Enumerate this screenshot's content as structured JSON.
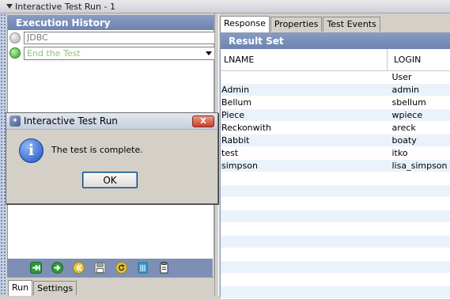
{
  "window": {
    "title": "Interactive Test Run - 1"
  },
  "history": {
    "header": "Execution History",
    "steps": [
      {
        "label": "JDBC"
      },
      {
        "label": "End the Test"
      }
    ]
  },
  "left_tabs": [
    {
      "label": "Run"
    },
    {
      "label": "Settings"
    }
  ],
  "toolbar": {
    "icons": [
      "step-into-icon",
      "step-forward-icon",
      "rewind-icon",
      "save-icon",
      "restart-icon",
      "delete-icon",
      "clipboard-icon"
    ]
  },
  "right_tabs": [
    {
      "label": "Response"
    },
    {
      "label": "Properties"
    },
    {
      "label": "Test Events"
    }
  ],
  "result_set": {
    "header": "Result Set",
    "columns": [
      "LNAME",
      "LOGIN"
    ],
    "rows": [
      [
        "",
        "User"
      ],
      [
        "Admin",
        "admin"
      ],
      [
        "Bellum",
        "sbellum"
      ],
      [
        "Piece",
        "wpiece"
      ],
      [
        "Reckonwith",
        "areck"
      ],
      [
        "Rabbit",
        "boaty"
      ],
      [
        "test",
        "itko"
      ],
      [
        "simpson",
        "lisa_simpson"
      ]
    ]
  },
  "dialog": {
    "title": "Interactive Test Run",
    "message": "The test is complete.",
    "ok_label": "OK",
    "close_glyph": "X"
  }
}
